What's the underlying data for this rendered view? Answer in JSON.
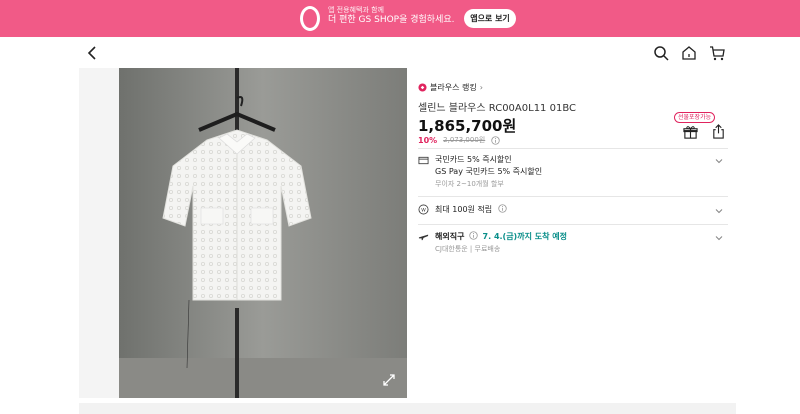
{
  "banner": {
    "small_text": "앱 전용혜택과 함께",
    "main_text": "더 편한 GS SHOP을 경험하세요.",
    "button_label": "앱으로 보기"
  },
  "nav": {
    "back_icon": "back-arrow-icon",
    "search_icon": "search-icon",
    "home_icon": "home-icon",
    "cart_icon": "cart-icon"
  },
  "product": {
    "rank_label": "블라우스 랭킹",
    "rank_chevron": "›",
    "title": "셀린느 블라우스 RC00A0L11 01BC",
    "price": "1,865,700원",
    "discount": "10%",
    "original_price": "2,073,000원",
    "gift_badge": "선물포장가능"
  },
  "rows": {
    "card": {
      "line1": "국민카드 5% 즉시할인",
      "line2": "GS Pay 국민카드 5% 즉시할인",
      "sub": "무이자 2~10개월 할부"
    },
    "points": {
      "line1": "최대 100원 적립"
    },
    "shipping": {
      "label": "해외직구",
      "date": "7. 4.(금)까지 도착 예정",
      "sub": "CJ대한통운 | 무료배송"
    }
  },
  "colors": {
    "banner": "#f15a87",
    "discount": "#e0245e",
    "accent": "#0a8f8a"
  }
}
